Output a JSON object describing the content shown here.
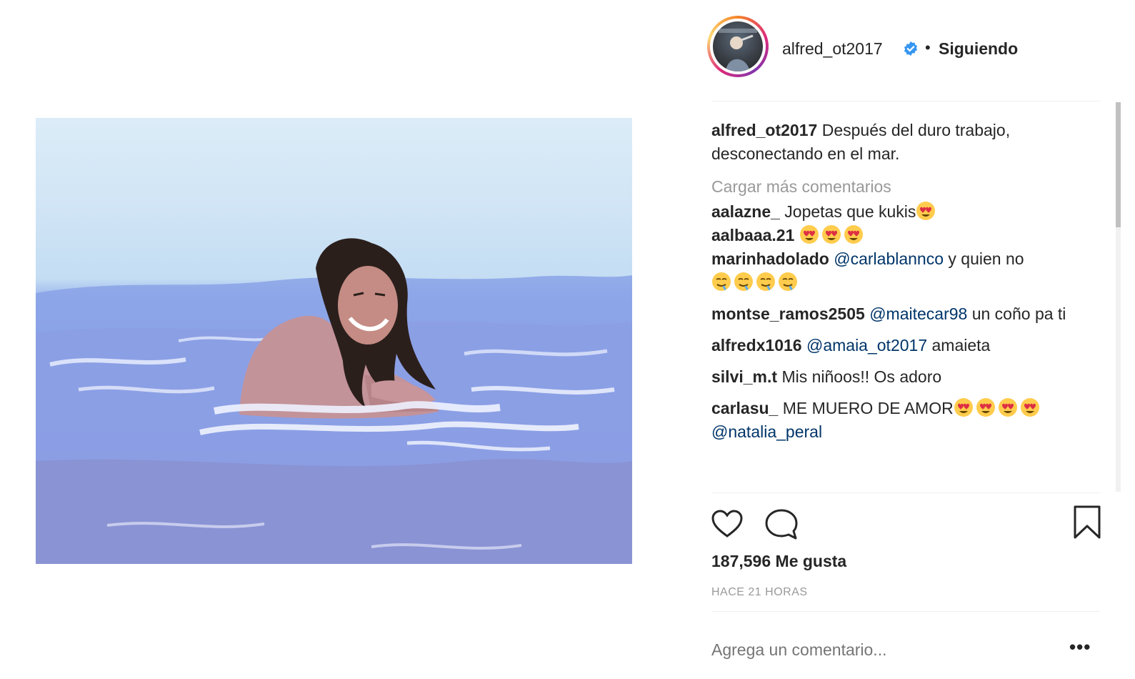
{
  "post": {
    "photo_icon": "beach-photo"
  },
  "header": {
    "username": "alfred_ot2017",
    "separator": "•",
    "follow_label": "Siguiendo",
    "verified_icon": "verified-badge-icon",
    "verified_color": "#3897f0"
  },
  "caption": {
    "username": "alfred_ot2017",
    "text": "Después del duro trabajo, desconectando en el mar."
  },
  "load_more_label": "Cargar más comentarios",
  "comments": [
    {
      "user": "aalazne_",
      "text": "Jopetas que kukis",
      "emoji": [
        "heart-eyes"
      ]
    },
    {
      "user": "aalbaaa.21",
      "text": "",
      "emoji": [
        "heart-eyes",
        "heart-eyes",
        "heart-eyes"
      ]
    },
    {
      "user": "marinhadolado",
      "mention": "@carlablannco",
      "text": "y quien no",
      "emoji": [
        "drooling",
        "drooling",
        "drooling",
        "drooling"
      ]
    },
    {
      "user": "montse_ramos2505",
      "mention": "@maitecar98",
      "text": "un coño pa ti"
    },
    {
      "user": "alfredx1016",
      "mention": "@amaia_ot2017",
      "text": "amaieta"
    },
    {
      "user": "silvi_m.t",
      "text": "Mis niñoos!! Os adoro"
    },
    {
      "user": "carlasu_",
      "text": "ME MUERO DE AMOR",
      "emoji": [
        "heart-eyes",
        "heart-eyes",
        "heart-eyes",
        "heart-eyes"
      ],
      "mention_after": "@natalia_peral"
    }
  ],
  "actions": {
    "like_icon": "heart-icon",
    "comment_icon": "comment-bubble-icon",
    "save_icon": "bookmark-icon"
  },
  "likes_label": "187,596 Me gusta",
  "timestamp": "HACE 21 HORAS",
  "add_comment_placeholder": "Agrega un comentario...",
  "more_label": "•••",
  "colors": {
    "text": "#262626",
    "muted": "#999999",
    "mention": "#003569",
    "divider": "#efefef"
  }
}
